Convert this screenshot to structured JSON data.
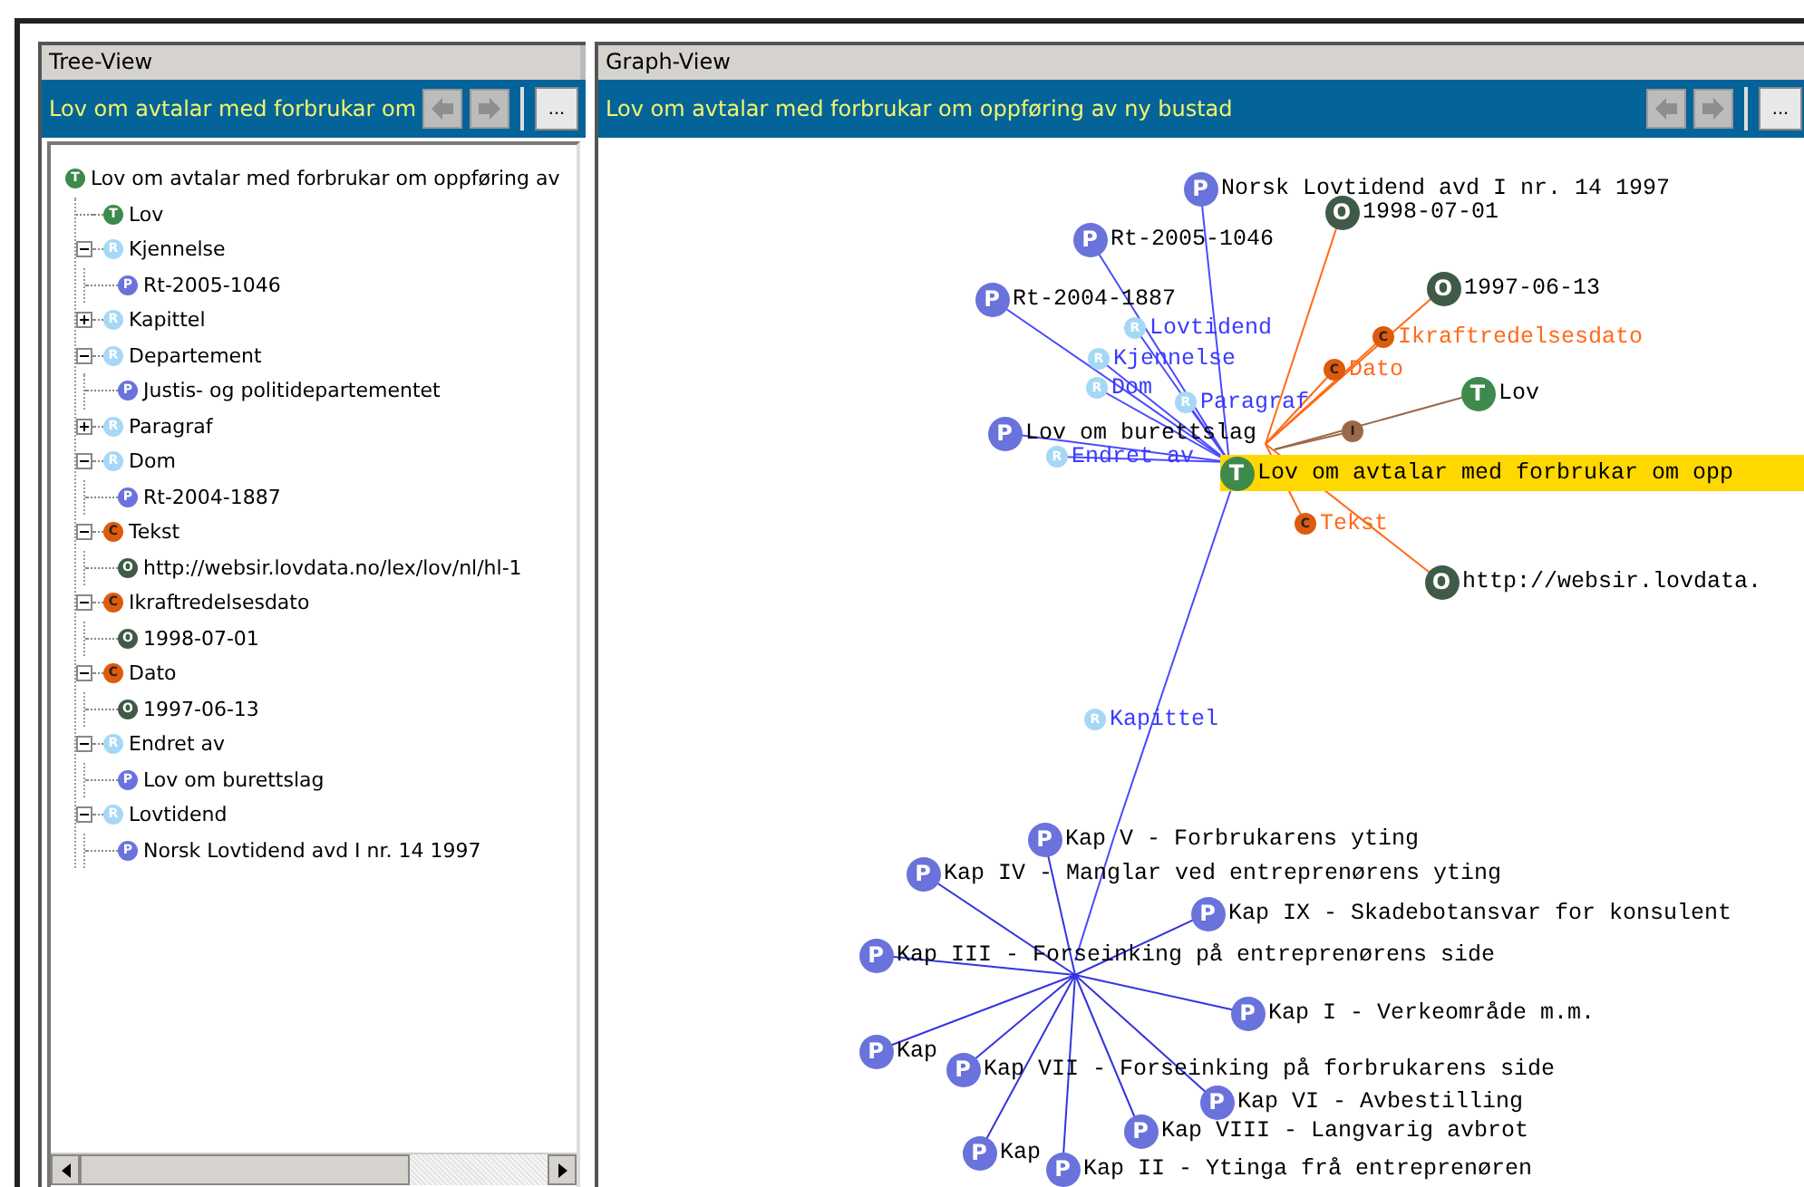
{
  "tree_panel": {
    "title": "Tree-View",
    "toolbar": {
      "title": "Lov om avtalar med forbrukar om",
      "more_button": "..."
    },
    "root": {
      "kind": "type",
      "badge": "T",
      "label": "Lov om avtalar med forbrukar om oppføring av",
      "children": [
        {
          "kind": "type",
          "badge": "T",
          "label": "Lov"
        },
        {
          "kind": "relation",
          "badge": "R",
          "label": "Kjennelse",
          "expanded": true,
          "children": [
            {
              "kind": "instance",
              "badge": "P",
              "label": "Rt-2005-1046"
            }
          ]
        },
        {
          "kind": "relation",
          "badge": "R",
          "label": "Kapittel",
          "expanded": false
        },
        {
          "kind": "relation",
          "badge": "R",
          "label": "Departement",
          "expanded": true,
          "children": [
            {
              "kind": "instance",
              "badge": "P",
              "label": "Justis- og politidepartementet"
            }
          ]
        },
        {
          "kind": "relation",
          "badge": "R",
          "label": "Paragraf",
          "expanded": false
        },
        {
          "kind": "relation",
          "badge": "R",
          "label": "Dom",
          "expanded": true,
          "children": [
            {
              "kind": "instance",
              "badge": "P",
              "label": "Rt-2004-1887"
            }
          ]
        },
        {
          "kind": "category",
          "badge": "C",
          "label": "Tekst",
          "expanded": true,
          "children": [
            {
              "kind": "literal",
              "badge": "O",
              "label": "http://websir.lovdata.no/lex/lov/nl/hl-1"
            }
          ]
        },
        {
          "kind": "category",
          "badge": "C",
          "label": "Ikraftredelsesdato",
          "expanded": true,
          "children": [
            {
              "kind": "literal",
              "badge": "O",
              "label": "1998-07-01"
            }
          ]
        },
        {
          "kind": "category",
          "badge": "C",
          "label": "Dato",
          "expanded": true,
          "children": [
            {
              "kind": "literal",
              "badge": "O",
              "label": "1997-06-13"
            }
          ]
        },
        {
          "kind": "relation",
          "badge": "R",
          "label": "Endret av",
          "expanded": true,
          "children": [
            {
              "kind": "instance",
              "badge": "P",
              "label": "Lov om burettslag"
            }
          ]
        },
        {
          "kind": "relation",
          "badge": "R",
          "label": "Lovtidend",
          "expanded": true,
          "children": [
            {
              "kind": "instance",
              "badge": "P",
              "label": "Norsk Lovtidend avd I nr. 14 1997"
            }
          ]
        }
      ]
    }
  },
  "graph_panel": {
    "title": "Graph-View",
    "toolbar": {
      "title": "Lov om avtalar med forbrukar om oppføring av ny bustad",
      "more_button": "..."
    },
    "nodes": [
      {
        "kind": "instance",
        "badge": "P",
        "label": "Norsk Lovtidend avd I nr. 14 1997",
        "selected": false
      },
      {
        "kind": "literal",
        "badge": "O",
        "label": "1998-07-01",
        "selected": false
      },
      {
        "kind": "instance",
        "badge": "P",
        "label": "Rt-2005-1046",
        "selected": false
      },
      {
        "kind": "literal",
        "badge": "O",
        "label": "1997-06-13",
        "selected": false
      },
      {
        "kind": "instance",
        "badge": "P",
        "label": "Rt-2004-1887",
        "selected": false
      },
      {
        "kind": "relation",
        "badge": "R",
        "label": "Lovtidend",
        "selected": false
      },
      {
        "kind": "category",
        "badge": "C",
        "label": "Ikraftredelsesdato",
        "selected": false
      },
      {
        "kind": "relation",
        "badge": "R",
        "label": "Kjennelse",
        "selected": false
      },
      {
        "kind": "relation",
        "badge": "R",
        "label": "Dom",
        "selected": false
      },
      {
        "kind": "relation",
        "badge": "R",
        "label": "Paragraf",
        "selected": false
      },
      {
        "kind": "category",
        "badge": "C",
        "label": "Dato",
        "selected": false
      },
      {
        "kind": "type",
        "badge": "T",
        "label": "Lov",
        "selected": false
      },
      {
        "kind": "instance",
        "badge": "P",
        "label": "Lov om burettslag",
        "selected": false
      },
      {
        "kind": "link",
        "badge": "I",
        "selected": false
      },
      {
        "kind": "relation",
        "badge": "R",
        "label": "Endret av",
        "selected": false
      },
      {
        "kind": "type",
        "badge": "T",
        "label": "Lov om avtalar med forbrukar om opp",
        "selected": true
      },
      {
        "kind": "category",
        "badge": "C",
        "label": "Tekst",
        "selected": false
      },
      {
        "kind": "literal",
        "badge": "O",
        "label": "http://websir.lovdata.",
        "selected": false
      },
      {
        "kind": "relation",
        "badge": "R",
        "label": "Kapittel",
        "selected": false
      },
      {
        "kind": "instance",
        "badge": "P",
        "label": "Kap V - Forbrukarens yting",
        "selected": false
      },
      {
        "kind": "instance",
        "badge": "P",
        "label": "Kap IV - Manglar ved entreprenørens yting",
        "selected": false
      },
      {
        "kind": "instance",
        "badge": "P",
        "label": "Kap IX - Skadebotansvar for konsulent",
        "selected": false
      },
      {
        "kind": "instance",
        "badge": "P",
        "label": "Kap III - Forseinking på entreprenørens side",
        "selected": false
      },
      {
        "kind": "instance",
        "badge": "P",
        "label": "Kap I - Verkeområde m.m.",
        "selected": false
      },
      {
        "kind": "instance",
        "badge": "P",
        "label": "Kap",
        "selected": false
      },
      {
        "kind": "instance",
        "badge": "P",
        "label": "Kap VII - Forseinking på forbrukarens side",
        "selected": false
      },
      {
        "kind": "instance",
        "badge": "P",
        "label": "Kap VI - Avbestilling",
        "selected": false
      },
      {
        "kind": "instance",
        "badge": "P",
        "label": "Kap VIII - Langvarig avbrot",
        "selected": false
      },
      {
        "kind": "instance",
        "badge": "P",
        "label": "Kap",
        "selected": false
      },
      {
        "kind": "instance",
        "badge": "P",
        "label": "Kap II - Ytinga frå entreprenøren",
        "selected": false
      }
    ]
  }
}
